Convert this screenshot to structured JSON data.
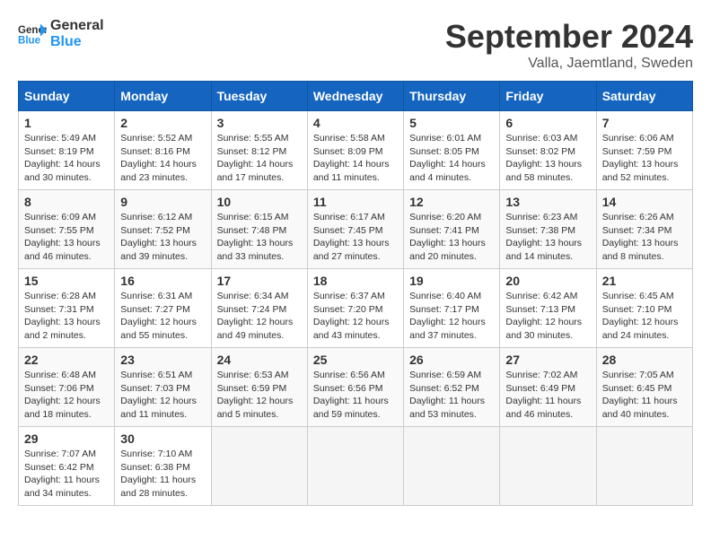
{
  "header": {
    "logo_general": "General",
    "logo_blue": "Blue",
    "month": "September 2024",
    "location": "Valla, Jaemtland, Sweden"
  },
  "columns": [
    "Sunday",
    "Monday",
    "Tuesday",
    "Wednesday",
    "Thursday",
    "Friday",
    "Saturday"
  ],
  "weeks": [
    [
      {
        "day": "1",
        "info": "Sunrise: 5:49 AM\nSunset: 8:19 PM\nDaylight: 14 hours\nand 30 minutes."
      },
      {
        "day": "2",
        "info": "Sunrise: 5:52 AM\nSunset: 8:16 PM\nDaylight: 14 hours\nand 23 minutes."
      },
      {
        "day": "3",
        "info": "Sunrise: 5:55 AM\nSunset: 8:12 PM\nDaylight: 14 hours\nand 17 minutes."
      },
      {
        "day": "4",
        "info": "Sunrise: 5:58 AM\nSunset: 8:09 PM\nDaylight: 14 hours\nand 11 minutes."
      },
      {
        "day": "5",
        "info": "Sunrise: 6:01 AM\nSunset: 8:05 PM\nDaylight: 14 hours\nand 4 minutes."
      },
      {
        "day": "6",
        "info": "Sunrise: 6:03 AM\nSunset: 8:02 PM\nDaylight: 13 hours\nand 58 minutes."
      },
      {
        "day": "7",
        "info": "Sunrise: 6:06 AM\nSunset: 7:59 PM\nDaylight: 13 hours\nand 52 minutes."
      }
    ],
    [
      {
        "day": "8",
        "info": "Sunrise: 6:09 AM\nSunset: 7:55 PM\nDaylight: 13 hours\nand 46 minutes."
      },
      {
        "day": "9",
        "info": "Sunrise: 6:12 AM\nSunset: 7:52 PM\nDaylight: 13 hours\nand 39 minutes."
      },
      {
        "day": "10",
        "info": "Sunrise: 6:15 AM\nSunset: 7:48 PM\nDaylight: 13 hours\nand 33 minutes."
      },
      {
        "day": "11",
        "info": "Sunrise: 6:17 AM\nSunset: 7:45 PM\nDaylight: 13 hours\nand 27 minutes."
      },
      {
        "day": "12",
        "info": "Sunrise: 6:20 AM\nSunset: 7:41 PM\nDaylight: 13 hours\nand 20 minutes."
      },
      {
        "day": "13",
        "info": "Sunrise: 6:23 AM\nSunset: 7:38 PM\nDaylight: 13 hours\nand 14 minutes."
      },
      {
        "day": "14",
        "info": "Sunrise: 6:26 AM\nSunset: 7:34 PM\nDaylight: 13 hours\nand 8 minutes."
      }
    ],
    [
      {
        "day": "15",
        "info": "Sunrise: 6:28 AM\nSunset: 7:31 PM\nDaylight: 13 hours\nand 2 minutes."
      },
      {
        "day": "16",
        "info": "Sunrise: 6:31 AM\nSunset: 7:27 PM\nDaylight: 12 hours\nand 55 minutes."
      },
      {
        "day": "17",
        "info": "Sunrise: 6:34 AM\nSunset: 7:24 PM\nDaylight: 12 hours\nand 49 minutes."
      },
      {
        "day": "18",
        "info": "Sunrise: 6:37 AM\nSunset: 7:20 PM\nDaylight: 12 hours\nand 43 minutes."
      },
      {
        "day": "19",
        "info": "Sunrise: 6:40 AM\nSunset: 7:17 PM\nDaylight: 12 hours\nand 37 minutes."
      },
      {
        "day": "20",
        "info": "Sunrise: 6:42 AM\nSunset: 7:13 PM\nDaylight: 12 hours\nand 30 minutes."
      },
      {
        "day": "21",
        "info": "Sunrise: 6:45 AM\nSunset: 7:10 PM\nDaylight: 12 hours\nand 24 minutes."
      }
    ],
    [
      {
        "day": "22",
        "info": "Sunrise: 6:48 AM\nSunset: 7:06 PM\nDaylight: 12 hours\nand 18 minutes."
      },
      {
        "day": "23",
        "info": "Sunrise: 6:51 AM\nSunset: 7:03 PM\nDaylight: 12 hours\nand 11 minutes."
      },
      {
        "day": "24",
        "info": "Sunrise: 6:53 AM\nSunset: 6:59 PM\nDaylight: 12 hours\nand 5 minutes."
      },
      {
        "day": "25",
        "info": "Sunrise: 6:56 AM\nSunset: 6:56 PM\nDaylight: 11 hours\nand 59 minutes."
      },
      {
        "day": "26",
        "info": "Sunrise: 6:59 AM\nSunset: 6:52 PM\nDaylight: 11 hours\nand 53 minutes."
      },
      {
        "day": "27",
        "info": "Sunrise: 7:02 AM\nSunset: 6:49 PM\nDaylight: 11 hours\nand 46 minutes."
      },
      {
        "day": "28",
        "info": "Sunrise: 7:05 AM\nSunset: 6:45 PM\nDaylight: 11 hours\nand 40 minutes."
      }
    ],
    [
      {
        "day": "29",
        "info": "Sunrise: 7:07 AM\nSunset: 6:42 PM\nDaylight: 11 hours\nand 34 minutes."
      },
      {
        "day": "30",
        "info": "Sunrise: 7:10 AM\nSunset: 6:38 PM\nDaylight: 11 hours\nand 28 minutes."
      },
      {
        "day": "",
        "info": ""
      },
      {
        "day": "",
        "info": ""
      },
      {
        "day": "",
        "info": ""
      },
      {
        "day": "",
        "info": ""
      },
      {
        "day": "",
        "info": ""
      }
    ]
  ]
}
